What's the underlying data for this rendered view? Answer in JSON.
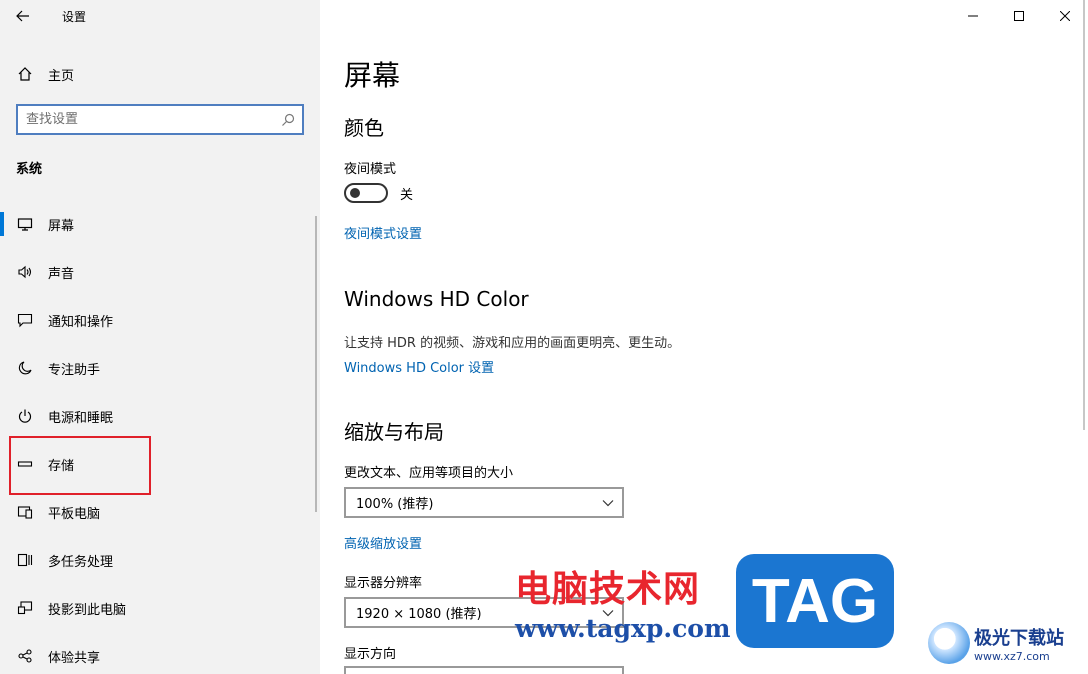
{
  "app": {
    "title": "设置"
  },
  "sidebar": {
    "home_label": "主页",
    "search_placeholder": "查找设置",
    "section_label": "系统",
    "items": [
      {
        "label": "屏幕",
        "icon": "monitor-icon"
      },
      {
        "label": "声音",
        "icon": "speaker-icon"
      },
      {
        "label": "通知和操作",
        "icon": "message-icon"
      },
      {
        "label": "专注助手",
        "icon": "moon-icon"
      },
      {
        "label": "电源和睡眠",
        "icon": "power-icon"
      },
      {
        "label": "存储",
        "icon": "drive-icon"
      },
      {
        "label": "平板电脑",
        "icon": "tablet-icon"
      },
      {
        "label": "多任务处理",
        "icon": "multitask-icon"
      },
      {
        "label": "投影到此电脑",
        "icon": "project-icon"
      },
      {
        "label": "体验共享",
        "icon": "share-icon"
      }
    ]
  },
  "main": {
    "page_title": "屏幕",
    "color": {
      "heading": "颜色",
      "night_mode_label": "夜间模式",
      "night_mode_state": "关",
      "night_mode_link": "夜间模式设置"
    },
    "hdr": {
      "heading": "Windows HD Color",
      "description": "让支持 HDR 的视频、游戏和应用的画面更明亮、更生动。",
      "link": "Windows HD Color 设置"
    },
    "scale": {
      "heading": "缩放与布局",
      "size_label": "更改文本、应用等项目的大小",
      "size_value": "100% (推荐)",
      "advanced_link": "高级缩放设置",
      "resolution_label": "显示器分辨率",
      "resolution_value": "1920 × 1080 (推荐)",
      "orientation_label": "显示方向"
    }
  },
  "watermark": {
    "site_name": "电脑技术网",
    "site_url": "www.tagxp.com",
    "tag": "TAG",
    "xz_name": "极光下载站",
    "xz_url": "www.xz7.com"
  },
  "colors": {
    "accent": "#0078d7",
    "link": "#0063b1",
    "highlight": "#e0202a"
  }
}
